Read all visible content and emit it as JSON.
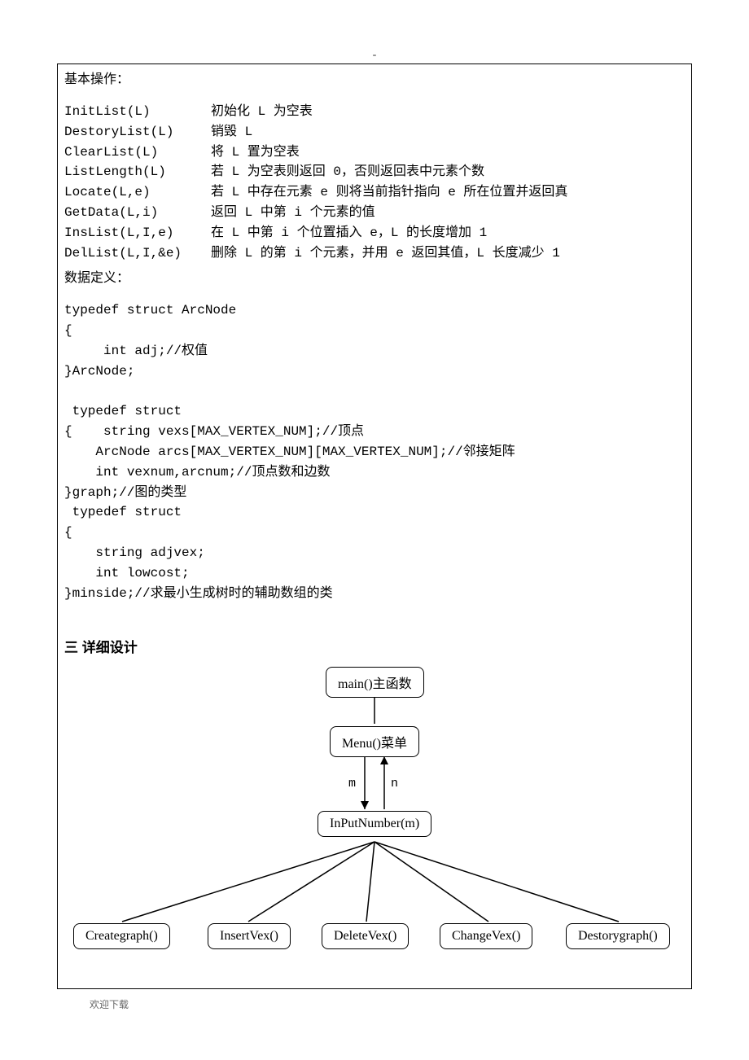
{
  "topDash": "-",
  "headings": {
    "basicOps": "基本操作：",
    "dataDef": "数据定义：",
    "section3": "三 详细设计"
  },
  "ops": [
    {
      "fn": "InitList(L)",
      "desc": "初始化 L 为空表"
    },
    {
      "fn": "DestoryList(L)",
      "desc": "销毁 L"
    },
    {
      "fn": "ClearList(L)",
      "desc": "将 L 置为空表"
    },
    {
      "fn": "ListLength(L)",
      "desc": "若 L 为空表则返回 0，否则返回表中元素个数"
    },
    {
      "fn": "Locate(L,e)",
      "desc": "若 L 中存在元素 e 则将当前指针指向 e 所在位置并返回真"
    },
    {
      "fn": "GetData(L,i)",
      "desc": "返回 L 中第 i 个元素的值"
    },
    {
      "fn": "InsList(L,I,e)",
      "desc": "在 L 中第 i 个位置插入 e，L 的长度增加 1"
    },
    {
      "fn": "DelList(L,I,&e)",
      "desc": "删除 L 的第 i 个元素，并用 e 返回其值，L 长度减少 1"
    }
  ],
  "code": "typedef struct ArcNode\n{\n     int adj;//权值\n}ArcNode;\n\n typedef struct\n{    string vexs[MAX_VERTEX_NUM];//顶点\n    ArcNode arcs[MAX_VERTEX_NUM][MAX_VERTEX_NUM];//邻接矩阵\n    int vexnum,arcnum;//顶点数和边数\n}graph;//图的类型\n typedef struct\n{\n    string adjvex;\n    int lowcost;\n}minside;//求最小生成树时的辅助数组的类",
  "diagram": {
    "main": "main()主函数",
    "menu": "Menu()菜单",
    "input": "InPutNumber(m)",
    "edgeM": "m",
    "edgeN": "n",
    "leaves": {
      "create": "Creategraph()",
      "insert": "InsertVex()",
      "delete": "DeleteVex()",
      "change": "ChangeVex()",
      "destory": "Destorygraph()"
    }
  },
  "footer": "欢迎下载"
}
